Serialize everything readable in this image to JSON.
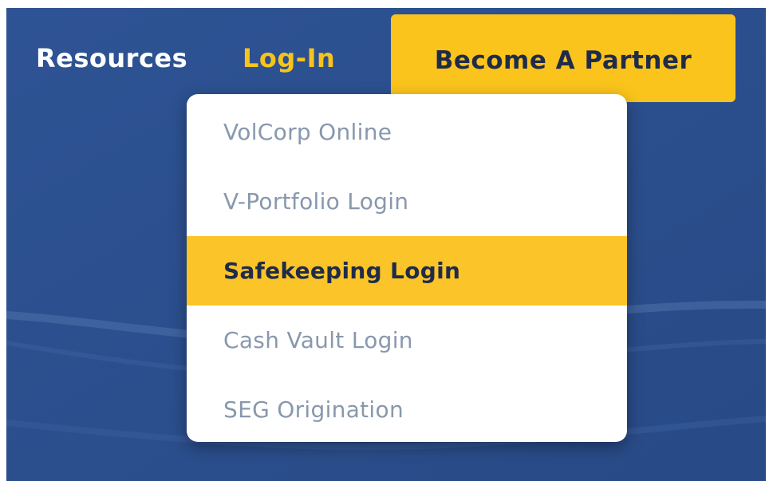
{
  "nav": {
    "resources_label": "Resources",
    "login_label": "Log-In",
    "partner_button_label": "Become A Partner"
  },
  "login_menu": {
    "items": [
      {
        "label": "VolCorp Online"
      },
      {
        "label": "V-Portfolio Login"
      },
      {
        "label": "Safekeeping Login"
      },
      {
        "label": "Cash Vault Login"
      },
      {
        "label": "SEG Origination"
      }
    ],
    "highlighted_item": "Safekeeping Login"
  },
  "colors": {
    "background": "#2c4f8c",
    "accent_yellow": "#fbc41c",
    "login_link": "#f7c41e",
    "menu_text": "#8898ad",
    "active_text": "#1f2b4a"
  }
}
